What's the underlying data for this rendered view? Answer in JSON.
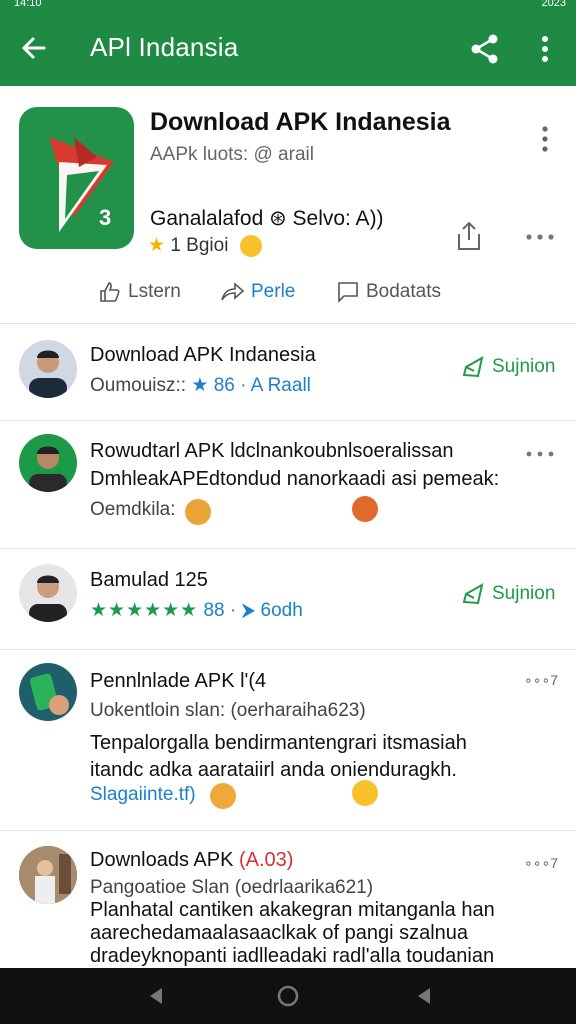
{
  "status_bar": {
    "time": "14:10",
    "right_text": "2023"
  },
  "app_bar": {
    "title": "APl Indansia",
    "back_icon": "arrow-back-icon",
    "share_icon": "share-icon",
    "more_icon": "more-vert-icon"
  },
  "header": {
    "app_name": "Download APK Indanesia",
    "subtitle": "AAPk luots: @ arail",
    "line2": "Ganalalafod ⊛ Selvo: A))",
    "rating_star": "★",
    "rating_text": "1 Bgioi",
    "icon_badge": "3",
    "actions": [
      {
        "label": "Lstern",
        "icon": "thumb-up-icon"
      },
      {
        "label": "Perle",
        "icon": "share-arrow-icon"
      },
      {
        "label": "Bodatats",
        "icon": "comment-icon"
      }
    ]
  },
  "rows": [
    {
      "title": "Download APK Indanesia",
      "meta_a": "Oumouisz::",
      "meta_star": "★",
      "meta_b": "86",
      "meta_c": "· A Raall",
      "action": "Sujnion"
    },
    {
      "title": "Rowudtarl APK ldclnankoubnlsoeralissan",
      "line2": "DmhleakAPEdtondud nanorkaadi asi pemeak:",
      "meta_a": "Oemdkila:"
    },
    {
      "title": "Bamulad 125",
      "meta_stars": "★★★★★★",
      "meta_b": "88",
      "meta_c": "· ⮞ 6odh",
      "action": "Sujnion"
    },
    {
      "title": "Pennlnlade APK l'(4",
      "sub": "Uokentloin slan: (oerharaiha623)",
      "body1": "Tenpalorgalla bendirmantengrari itsmasiah",
      "body2": "itandc adka aarataiirl anda onienduragkh.",
      "link": "Slagaiinte.tf)",
      "dots_text": "∘∘∘7"
    },
    {
      "title": "Downloads APK",
      "title_red": "(A.03)",
      "sub": "Pangoatioe Slan (oedrlaarika621)",
      "body1": "Planhatal cantiken akakegran mitanganla han",
      "body2": "aarechedamaalasaaclkak of pangi szalnua",
      "body3": "dradeyknopanti iadlleadaki radl'alla toudanian",
      "dots_text": "∘∘∘7"
    }
  ],
  "colors": {
    "brand": "#1e8a44",
    "accent_blue": "#1c80c8",
    "accent_green": "#1e9a4c",
    "star": "#f4b400"
  }
}
